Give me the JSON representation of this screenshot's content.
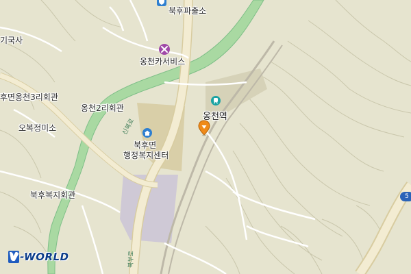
{
  "map": {
    "labels": {
      "police_box": "북후파출소",
      "gukgisa": "기국사",
      "car_service": "옹천카서비스",
      "ongcheon3_hall": "후면옹천3리회관",
      "ongcheon2_hall": "옹천2리회관",
      "station": "옹천역",
      "obokjeongmiso": "오복정미소",
      "admin_center_line1": "북후면",
      "admin_center_line2": "행정복지센터",
      "welfare_hall": "북후복지회관"
    },
    "road_labels": {
      "sinbukro": "신북로",
      "south_road": "북부로"
    },
    "route_shield": "5",
    "brand": {
      "v": "V",
      "text": "-WORLD"
    },
    "colors": {
      "background": "#e6e4cf",
      "river": "#a9d9a2",
      "river_edge": "#7fbf88",
      "major_road": "#f3ecd2",
      "major_road_edge": "#d8cca0",
      "minor_road": "#ffffff",
      "railway": "#bdb8a8",
      "station_area": "#d6d2b8",
      "industrial_area": "#cfc9d6",
      "admin_area": "#d9cfa8",
      "contour": "#c9c6ab",
      "icon_blue": "#2e7fd0",
      "icon_purple": "#a049a8",
      "icon_teal": "#1aa3a3",
      "marker_orange": "#ef8a18"
    },
    "icons": [
      "police-icon",
      "car-repair-icon",
      "railway-station-icon",
      "government-office-icon",
      "location-pin-icon"
    ]
  }
}
